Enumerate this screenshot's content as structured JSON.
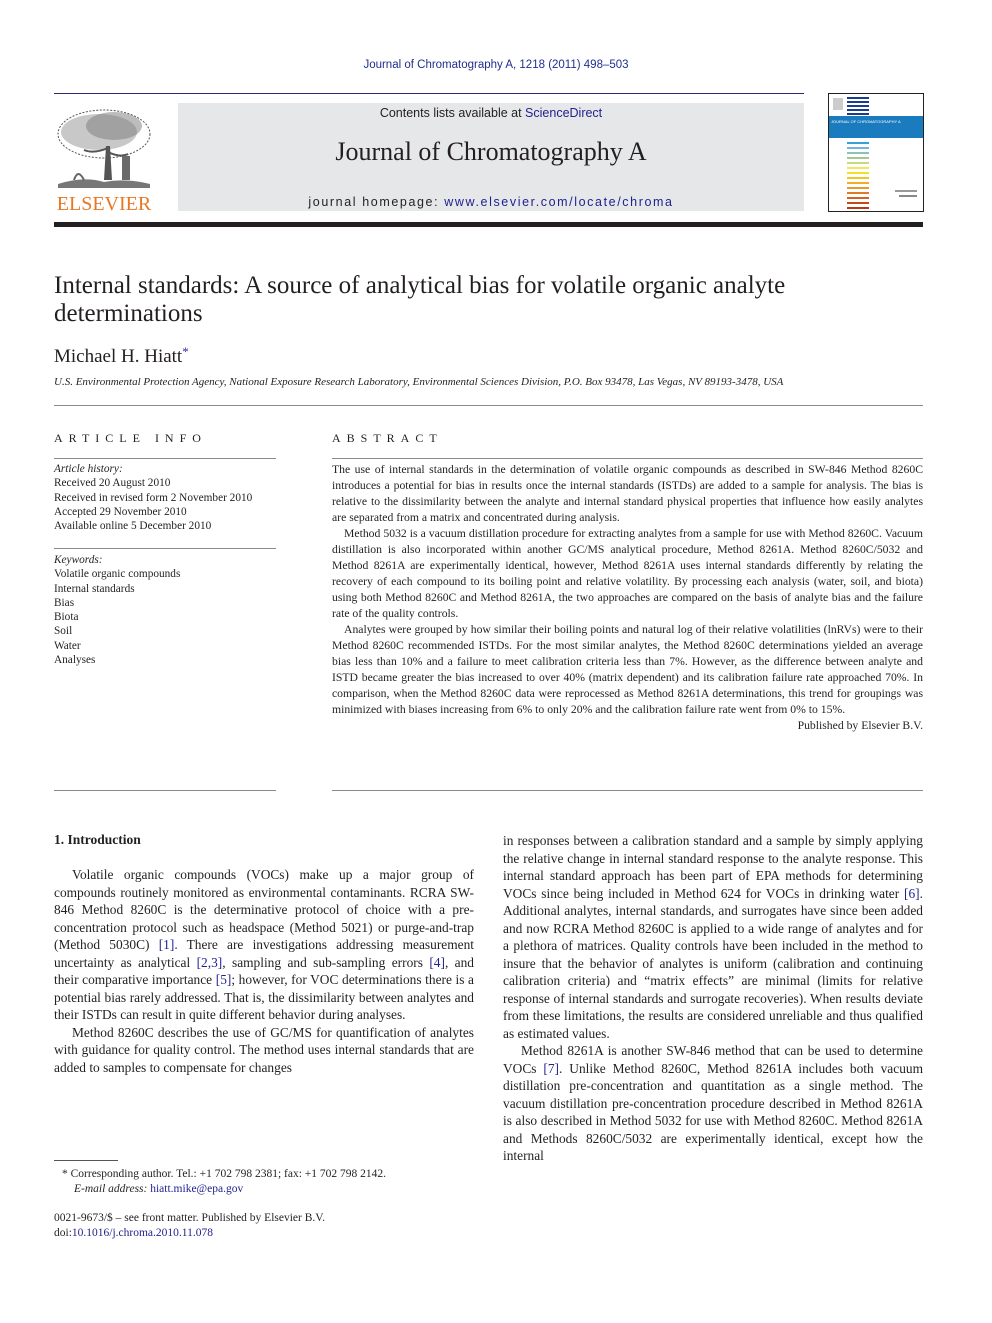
{
  "running_head": "Journal of Chromatography A, 1218 (2011) 498–503",
  "header": {
    "publisher_logo_text": "ELSEVIER",
    "contents_prefix": "Contents lists available at ",
    "contents_link": "ScienceDirect",
    "journal_title": "Journal of Chromatography A",
    "homepage_prefix": "journal homepage: ",
    "homepage_link": "www.elsevier.com/locate/chroma",
    "cover_title": "JOURNAL OF CHROMATOGRAPHY A",
    "colors": {
      "logo_orange": "#e87722",
      "link_blue": "#1f1f8f",
      "banner_gray": "#e6e7e8",
      "cover_blue": "#1a7bbf"
    }
  },
  "article": {
    "title": "Internal standards: A source of analytical bias for volatile organic analyte determinations",
    "author": "Michael H. Hiatt",
    "author_mark": "*",
    "affiliation": "U.S. Environmental Protection Agency, National Exposure Research Laboratory, Environmental Sciences Division, P.O. Box 93478, Las Vegas, NV 89193-3478, USA"
  },
  "article_info": {
    "heading": "ARTICLE INFO",
    "history_label": "Article history:",
    "history": [
      "Received 20 August 2010",
      "Received in revised form 2 November 2010",
      "Accepted 29 November 2010",
      "Available online 5 December 2010"
    ],
    "keywords_label": "Keywords:",
    "keywords": [
      "Volatile organic compounds",
      "Internal standards",
      "Bias",
      "Biota",
      "Soil",
      "Water",
      "Analyses"
    ]
  },
  "abstract": {
    "heading": "ABSTRACT",
    "paragraphs": [
      "The use of internal standards in the determination of volatile organic compounds as described in SW-846 Method 8260C introduces a potential for bias in results once the internal standards (ISTDs) are added to a sample for analysis. The bias is relative to the dissimilarity between the analyte and internal standard physical properties that influence how easily analytes are separated from a matrix and concentrated during analysis.",
      "Method 5032 is a vacuum distillation procedure for extracting analytes from a sample for use with Method 8260C. Vacuum distillation is also incorporated within another GC/MS analytical procedure, Method 8261A. Method 8260C/5032 and Method 8261A are experimentally identical, however, Method 8261A uses internal standards differently by relating the recovery of each compound to its boiling point and relative volatility. By processing each analysis (water, soil, and biota) using both Method 8260C and Method 8261A, the two approaches are compared on the basis of analyte bias and the failure rate of the quality controls.",
      "Analytes were grouped by how similar their boiling points and natural log of their relative volatilities (lnRVs) were to their Method 8260C recommended ISTDs. For the most similar analytes, the Method 8260C determinations yielded an average bias less than 10% and a failure to meet calibration criteria less than 7%. However, as the difference between analyte and ISTD became greater the bias increased to over 40% (matrix dependent) and its calibration failure rate approached 70%. In comparison, when the Method 8260C data were reprocessed as Method 8261A determinations, this trend for groupings was minimized with biases increasing from 6% to only 20% and the calibration failure rate went from 0% to 15%."
    ],
    "published_by": "Published by Elsevier B.V."
  },
  "introduction": {
    "heading": "1.  Introduction",
    "left_col": [
      {
        "parts": [
          {
            "t": "Volatile organic compounds (VOCs) make up a major group of compounds routinely monitored as environmental contaminants. RCRA SW-846 Method 8260C is the determinative protocol of choice with a pre-concentration protocol such as headspace (Method 5021) or purge-and-trap (Method 5030C) "
          },
          {
            "ref": "[1]"
          },
          {
            "t": ". There are investigations addressing measurement uncertainty as analytical "
          },
          {
            "ref": "[2,3]"
          },
          {
            "t": ", sampling and sub-sampling errors "
          },
          {
            "ref": "[4]"
          },
          {
            "t": ", and their comparative importance "
          },
          {
            "ref": "[5]"
          },
          {
            "t": "; however, for VOC determinations there is a potential bias rarely addressed. That is, the dissimilarity between analytes and their ISTDs can result in quite different behavior during analyses."
          }
        ]
      },
      {
        "parts": [
          {
            "t": "Method 8260C describes the use of GC/MS for quantification of analytes with guidance for quality control. The method uses internal standards that are added to samples to compensate for changes"
          }
        ]
      }
    ],
    "right_col": [
      {
        "continuation": true,
        "parts": [
          {
            "t": "in responses between a calibration standard and a sample by simply applying the relative change in internal standard response to the analyte response. This internal standard approach has been part of EPA methods for determining VOCs since being included in Method 624 for VOCs in drinking water "
          },
          {
            "ref": "[6]"
          },
          {
            "t": ". Additional analytes, internal standards, and surrogates have since been added and now RCRA Method 8260C is applied to a wide range of analytes and for a plethora of matrices. Quality controls have been included in the method to insure that the behavior of analytes is uniform (calibration and continuing calibration criteria) and “matrix effects” are minimal (limits for relative response of internal standards and surrogate recoveries). When results deviate from these limitations, the results are considered unreliable and thus qualified as estimated values."
          }
        ]
      },
      {
        "parts": [
          {
            "t": "Method 8261A is another SW-846 method that can be used to determine VOCs "
          },
          {
            "ref": "[7]"
          },
          {
            "t": ". Unlike Method 8260C, Method 8261A includes both vacuum distillation pre-concentration and quantitation as a single method. The vacuum distillation pre-concentration procedure described in Method 8261A is also described in Method 5032 for use with Method 8260C. Method 8261A and Methods 8260C/5032 are experimentally identical, except how the internal"
          }
        ]
      }
    ]
  },
  "footnote": {
    "corresponding": "*  Corresponding author. Tel.: +1 702 798 2381; fax: +1 702 798 2142.",
    "email_label": "E-mail address: ",
    "email": "hiatt.mike@epa.gov",
    "front_matter": "0021-9673/$ – see front matter. Published by Elsevier B.V.",
    "doi_prefix": "doi:",
    "doi": "10.1016/j.chroma.2010.11.078"
  }
}
